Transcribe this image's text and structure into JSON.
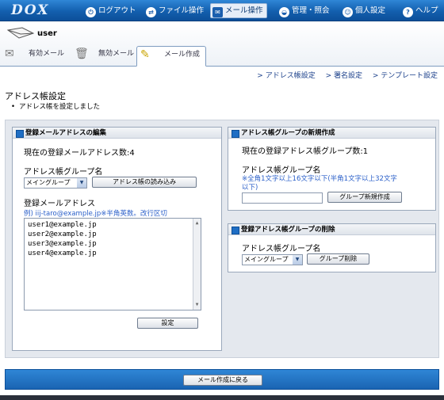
{
  "app": {
    "logo": "DOX"
  },
  "nav": {
    "items": [
      {
        "label": "ログアウト",
        "icon": "power-icon"
      },
      {
        "label": "ファイル操作",
        "icon": "file-icon"
      },
      {
        "label": "メール操作",
        "icon": "mail-icon",
        "active": true
      },
      {
        "label": "管理・照会",
        "icon": "admin-icon"
      },
      {
        "label": "個人設定",
        "icon": "person-icon"
      },
      {
        "label": "ヘルプ",
        "icon": "help-icon"
      }
    ]
  },
  "user": {
    "name": "user"
  },
  "tabs": [
    {
      "label": "有効メール",
      "icon": "envelope-icon"
    },
    {
      "label": "無効メール",
      "icon": "trash-icon"
    },
    {
      "label": "メール作成",
      "icon": "compose-icon",
      "active": true
    }
  ],
  "sublinks": [
    "> アドレス帳設定",
    "> 署名設定",
    "> テンプレート設定"
  ],
  "page": {
    "title": "アドレス帳設定",
    "message": "アドレス帳を設定しました"
  },
  "edit_panel": {
    "title": "登録メールアドレスの編集",
    "count_text": "現在の登録メールアドレス数:4",
    "group_label": "アドレス帳グループ名",
    "group_selected": "メイングループ",
    "load_button": "アドレス帳の読み込み",
    "address_label": "登録メールアドレス",
    "address_hint": "例) iij-taro@example.jp※半角英数。改行区切",
    "addresses": [
      "user1@example.jp",
      "user2@example.jp",
      "user3@example.jp",
      "user4@example.jp"
    ],
    "save_button": "設定"
  },
  "new_group_panel": {
    "title": "アドレス帳グループの新規作成",
    "count_text": "現在の登録アドレス帳グループ数:1",
    "group_label": "アドレス帳グループ名",
    "hint_line1": "※全角1文字以上16文字以下(半角1文字以上32文字",
    "hint_line2": "以下)",
    "input_value": "",
    "create_button": "グループ新規作成"
  },
  "delete_group_panel": {
    "title": "登録アドレス帳グループの削除",
    "group_label": "アドレス帳グループ名",
    "group_selected": "メイングループ",
    "delete_button": "グループ削除"
  },
  "footer": {
    "back_button": "メール作成に戻る"
  }
}
